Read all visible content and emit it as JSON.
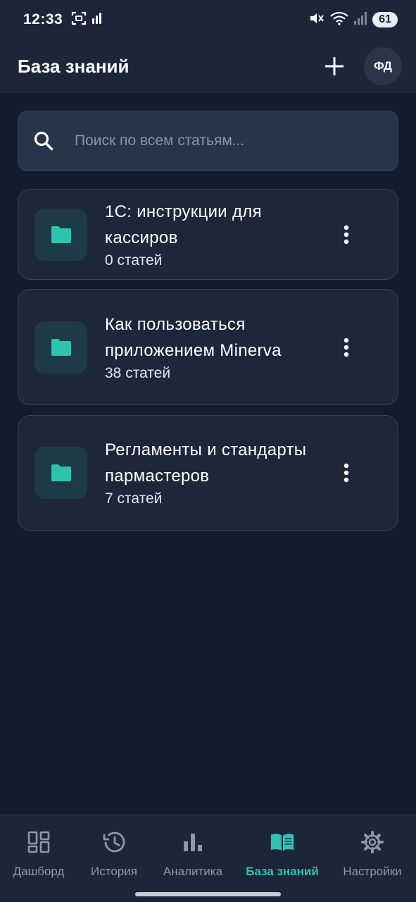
{
  "status_bar": {
    "time": "12:33",
    "battery": "61"
  },
  "header": {
    "title": "База знаний",
    "avatar_initials": "ФД"
  },
  "search": {
    "placeholder": "Поиск по всем статьям..."
  },
  "folders": [
    {
      "title": "1С: инструкции для кассиров",
      "count": "0 статей"
    },
    {
      "title": "Как пользоваться приложением Minerva",
      "count": "38 статей"
    },
    {
      "title": "Регламенты и стандарты пармастеров",
      "count": "7 статей"
    }
  ],
  "bottom_nav": [
    {
      "label": "Дашборд",
      "icon": "dashboard-icon",
      "active": false
    },
    {
      "label": "История",
      "icon": "history-icon",
      "active": false
    },
    {
      "label": "Аналитика",
      "icon": "bar-chart-icon",
      "active": false
    },
    {
      "label": "База знаний",
      "icon": "book-icon",
      "active": true
    },
    {
      "label": "Настройки",
      "icon": "gear-icon",
      "active": false
    }
  ],
  "colors": {
    "accent": "#2cc4b0",
    "background": "#111c2c",
    "surface": "#1c2638",
    "card": "#1d2739",
    "inactive": "#8e98a8"
  }
}
